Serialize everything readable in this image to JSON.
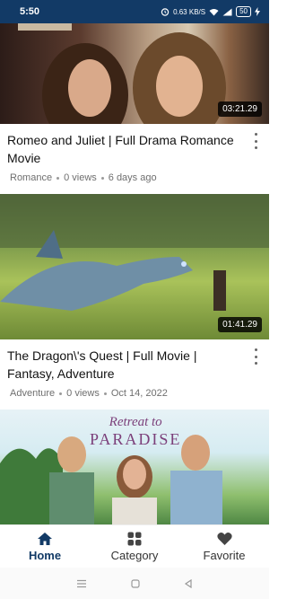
{
  "status_bar": {
    "time": "5:50",
    "network": "0.63 KB/S",
    "battery": "50"
  },
  "videos": [
    {
      "title": "Romeo and Juliet | Full Drama Romance Movie",
      "category": "Romance",
      "views": "0 views",
      "date": "6 days ago",
      "duration": "03:21.29"
    },
    {
      "title": "The Dragon\\'s Quest | Full Movie | Fantasy, Adventure",
      "category": "Adventure",
      "views": "0 views",
      "date": "Oct 14, 2022",
      "duration": "01:41.29"
    },
    {
      "poster_line1": "Retreat to",
      "poster_line2": "PARADISE"
    }
  ],
  "nav": {
    "home": "Home",
    "category": "Category",
    "favorite": "Favorite"
  },
  "colors": {
    "accent": "#123a66"
  }
}
